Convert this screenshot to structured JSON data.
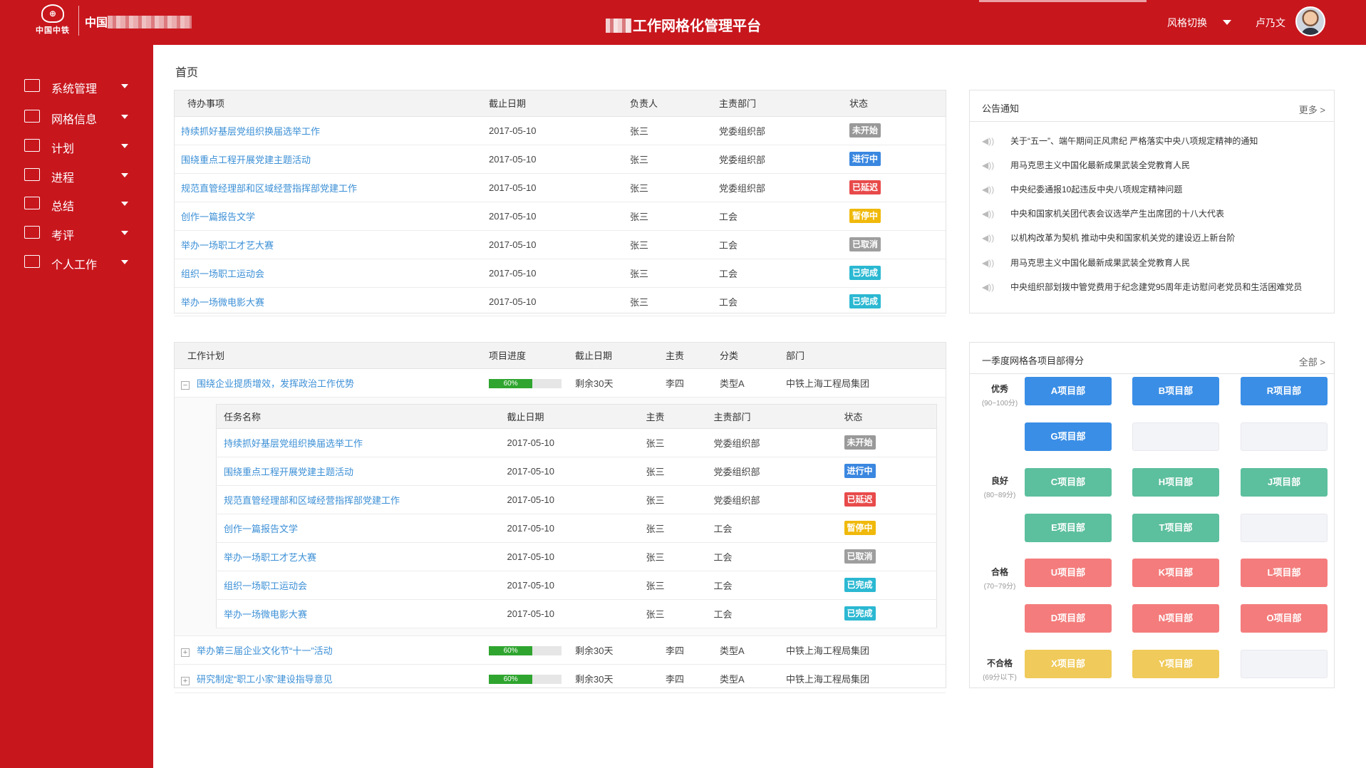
{
  "header": {
    "logo_text": "中国中铁",
    "company_visible": "中国",
    "platform_title": "工作网格化管理平台",
    "style_switch": "风格切换",
    "user_name": "卢乃文"
  },
  "sidebar": {
    "items": [
      {
        "label": "系统管理",
        "icon": "monitor-icon"
      },
      {
        "label": "网格信息",
        "icon": "document-icon"
      },
      {
        "label": "计划",
        "icon": "coins-icon"
      },
      {
        "label": "进程",
        "icon": "chart-icon"
      },
      {
        "label": "总结",
        "icon": "summary-icon"
      },
      {
        "label": "考评",
        "icon": "clipboard-icon"
      },
      {
        "label": "个人工作",
        "icon": "id-card-icon"
      }
    ]
  },
  "breadcrumb": "首页",
  "todo": {
    "headers": [
      "待办事项",
      "截止日期",
      "负责人",
      "主责部门",
      "状态"
    ],
    "rows": [
      {
        "title": "持续抓好基层党组织换届选举工作",
        "date": "2017-05-10",
        "owner": "张三",
        "dept": "党委组织部",
        "status": "未开始",
        "color": "#999999"
      },
      {
        "title": "围绕重点工程开展党建主题活动",
        "date": "2017-05-10",
        "owner": "张三",
        "dept": "党委组织部",
        "status": "进行中",
        "color": "#3a87e0"
      },
      {
        "title": "规范直管经理部和区域经营指挥部党建工作",
        "date": "2017-05-10",
        "owner": "张三",
        "dept": "党委组织部",
        "status": "已延迟",
        "color": "#e84a4a"
      },
      {
        "title": "创作一篇报告文学",
        "date": "2017-05-10",
        "owner": "张三",
        "dept": "工会",
        "status": "暂停中",
        "color": "#f0b90b"
      },
      {
        "title": "举办一场职工才艺大赛",
        "date": "2017-05-10",
        "owner": "张三",
        "dept": "工会",
        "status": "已取消",
        "color": "#9e9e9e"
      },
      {
        "title": "组织一场职工运动会",
        "date": "2017-05-10",
        "owner": "张三",
        "dept": "工会",
        "status": "已完成",
        "color": "#2bb8d2"
      },
      {
        "title": "举办一场微电影大赛",
        "date": "2017-05-10",
        "owner": "张三",
        "dept": "工会",
        "status": "已完成",
        "color": "#2bb8d2"
      }
    ]
  },
  "plan": {
    "headers": [
      "工作计划",
      "项目进度",
      "截止日期",
      "主责",
      "分类",
      "部门"
    ],
    "sub_headers": [
      "任务名称",
      "截止日期",
      "主责",
      "主责部门",
      "状态"
    ],
    "rows": [
      {
        "title": "围绕企业提质增效，发挥政治工作优势",
        "progress": 0.6,
        "progress_label": "60%",
        "deadline": "剩余30天",
        "owner": "李四",
        "category": "类型A",
        "dept": "中铁上海工程局集团",
        "expander": "−"
      },
      {
        "title": "举办第三届企业文化节“十一”活动",
        "progress": 0.6,
        "progress_label": "60%",
        "deadline": "剩余30天",
        "owner": "李四",
        "category": "类型A",
        "dept": "中铁上海工程局集团",
        "expander": "+"
      },
      {
        "title": "研究制定“职工小家”建设指导意见",
        "progress": 0.6,
        "progress_label": "60%",
        "deadline": "剩余30天",
        "owner": "李四",
        "category": "类型A",
        "dept": "中铁上海工程局集团",
        "expander": "+"
      }
    ],
    "tasks": [
      {
        "title": "持续抓好基层党组织换届选举工作",
        "date": "2017-05-10",
        "owner": "张三",
        "dept": "党委组织部",
        "status": "未开始",
        "color": "#999999"
      },
      {
        "title": "围绕重点工程开展党建主题活动",
        "date": "2017-05-10",
        "owner": "张三",
        "dept": "党委组织部",
        "status": "进行中",
        "color": "#3a87e0"
      },
      {
        "title": "规范直管经理部和区域经营指挥部党建工作",
        "date": "2017-05-10",
        "owner": "张三",
        "dept": "党委组织部",
        "status": "已延迟",
        "color": "#e84a4a"
      },
      {
        "title": "创作一篇报告文学",
        "date": "2017-05-10",
        "owner": "张三",
        "dept": "工会",
        "status": "暂停中",
        "color": "#f0b90b"
      },
      {
        "title": "举办一场职工才艺大赛",
        "date": "2017-05-10",
        "owner": "张三",
        "dept": "工会",
        "status": "已取消",
        "color": "#9e9e9e"
      },
      {
        "title": "组织一场职工运动会",
        "date": "2017-05-10",
        "owner": "张三",
        "dept": "工会",
        "status": "已完成",
        "color": "#2bb8d2"
      },
      {
        "title": "举办一场微电影大赛",
        "date": "2017-05-10",
        "owner": "张三",
        "dept": "工会",
        "status": "已完成",
        "color": "#2bb8d2"
      }
    ]
  },
  "notices": {
    "title": "公告通知",
    "more": "更多 >",
    "items": [
      "关于“五一”、端午期间正风肃纪 严格落实中央八项规定精神的通知",
      "用马克思主义中国化最新成果武装全党教育人民",
      "中央纪委通报10起违反中央八项规定精神问题",
      "中央和国家机关团代表会议选举产生出席团的十八大代表",
      "以机构改革为契机 推动中央和国家机关党的建设迈上新台阶",
      "用马克思主义中国化最新成果武装全党教育人民",
      "中央组织部划拨中管党费用于纪念建党95周年走访慰问老党员和生活困难党员"
    ]
  },
  "scores": {
    "title": "一季度网格各项目部得分",
    "all": "全部 >",
    "grades": [
      {
        "name": "优秀",
        "range": "(90~100分)"
      },
      {
        "name": "良好",
        "range": "(80~89分)"
      },
      {
        "name": "合格",
        "range": "(70~79分)"
      },
      {
        "name": "不合格",
        "range": "(69分以下)"
      }
    ],
    "rows": [
      {
        "color": "#3a8ee6",
        "depts": [
          "A项目部",
          "B项目部",
          "R项目部"
        ]
      },
      {
        "color": "#3a8ee6",
        "depts": [
          "G项目部",
          "",
          ""
        ]
      },
      {
        "color": "#5cbf9d",
        "depts": [
          "C项目部",
          "H项目部",
          "J项目部"
        ]
      },
      {
        "color": "#5cbf9d",
        "depts": [
          "E项目部",
          "T项目部",
          ""
        ]
      },
      {
        "color": "#f47c7c",
        "depts": [
          "U项目部",
          "K项目部",
          "L项目部"
        ]
      },
      {
        "color": "#f47c7c",
        "depts": [
          "D项目部",
          "N项目部",
          "O项目部"
        ]
      },
      {
        "color": "#f0ca5a",
        "depts": [
          "X项目部",
          "Y项目部",
          ""
        ]
      }
    ]
  }
}
